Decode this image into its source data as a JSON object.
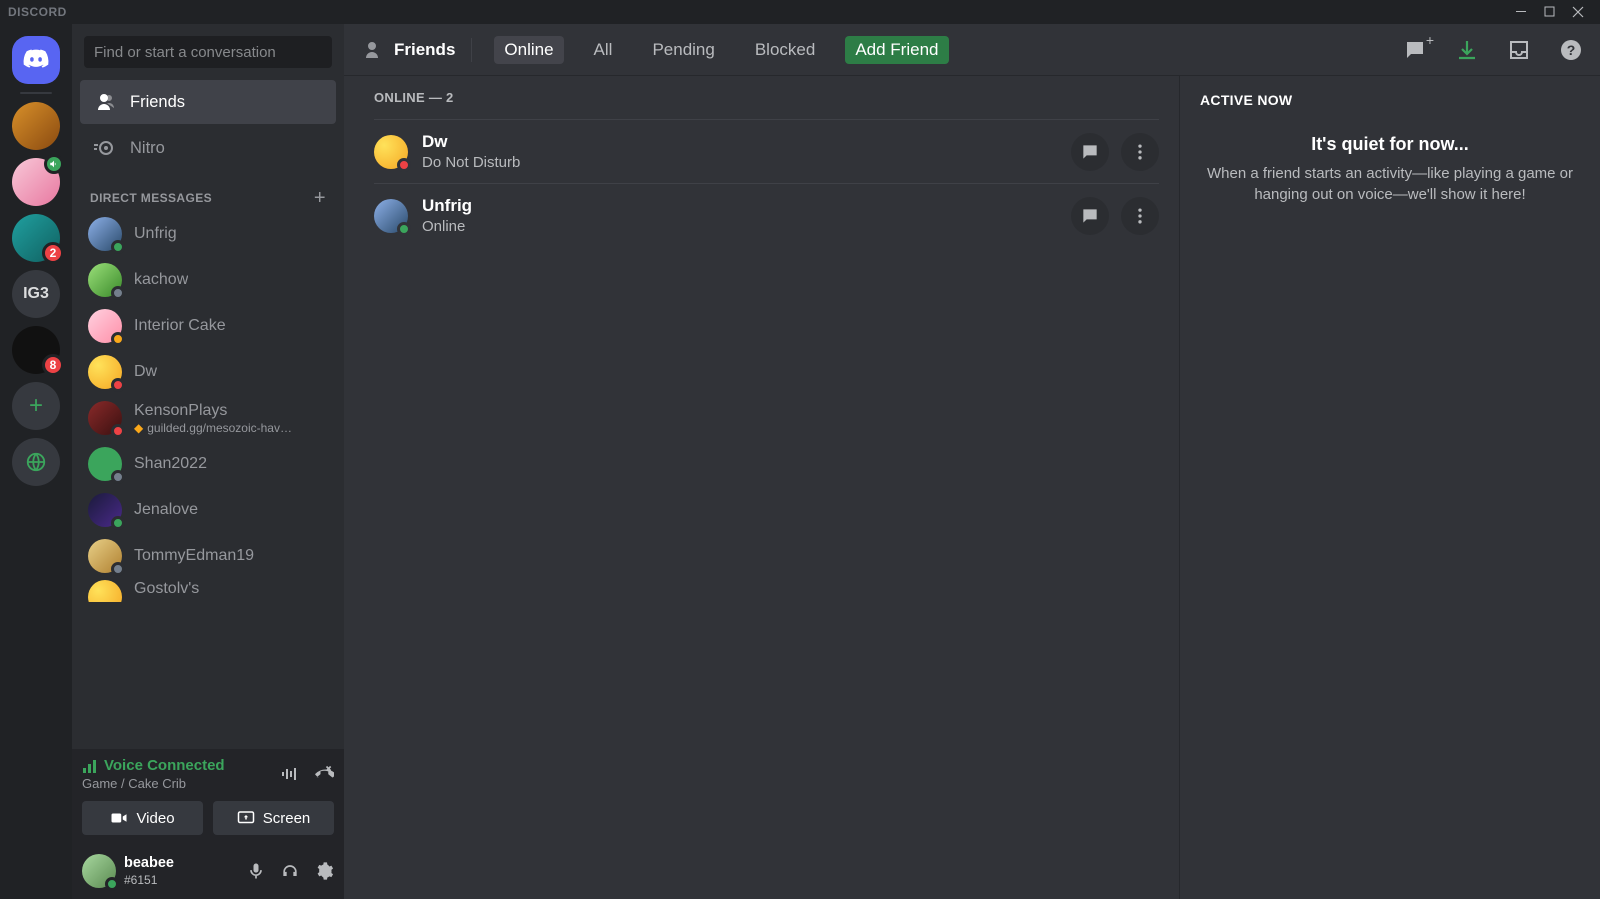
{
  "titlebar": {
    "brand": "DISCORD"
  },
  "rail": {
    "servers": [
      {
        "type": "home"
      },
      {
        "type": "img",
        "cls": "av10"
      },
      {
        "type": "img",
        "cls": "av11",
        "voice": true
      },
      {
        "type": "img",
        "cls": "av12",
        "badge": "2"
      },
      {
        "type": "text",
        "label": "IG3"
      },
      {
        "type": "img",
        "cls": "av13",
        "badge": "8"
      }
    ]
  },
  "sidebar": {
    "search_placeholder": "Find or start a conversation",
    "friends_label": "Friends",
    "nitro_label": "Nitro",
    "dm_header": "DIRECT MESSAGES",
    "dms": [
      {
        "name": "Unfrig",
        "av": "av1",
        "status": "mobile"
      },
      {
        "name": "kachow",
        "av": "av2",
        "status": "offline"
      },
      {
        "name": "Interior Cake",
        "av": "av3",
        "status": "idle"
      },
      {
        "name": "Dw",
        "av": "av4",
        "status": "dnd"
      },
      {
        "name": "KensonPlays",
        "av": "av5",
        "status": "dnd",
        "sub": "guilded.gg/mesozoic-hav…"
      },
      {
        "name": "Shan2022",
        "av": "av6",
        "status": "offline"
      },
      {
        "name": "Jenalove",
        "av": "av7",
        "status": "online"
      },
      {
        "name": "TommyEdman19",
        "av": "av8",
        "status": "offline"
      },
      {
        "name": "Gostolv's",
        "av": "av4",
        "status": "online",
        "cut": true
      }
    ]
  },
  "voice": {
    "status": "Voice Connected",
    "channel": "Game / Cake Crib",
    "video_label": "Video",
    "screen_label": "Screen"
  },
  "user": {
    "name": "beabee",
    "tag": "#6151",
    "av": "av9",
    "status": "online"
  },
  "topbar": {
    "title": "Friends",
    "tabs": {
      "online": "Online",
      "all": "All",
      "pending": "Pending",
      "blocked": "Blocked",
      "add": "Add Friend"
    }
  },
  "friends": {
    "section": "ONLINE — 2",
    "list": [
      {
        "name": "Dw",
        "status_text": "Do Not Disturb",
        "av": "av4",
        "status": "dnd"
      },
      {
        "name": "Unfrig",
        "status_text": "Online",
        "av": "av1",
        "status": "mobile"
      }
    ]
  },
  "active_now": {
    "title": "ACTIVE NOW",
    "heading": "It's quiet for now...",
    "body": "When a friend starts an activity—like playing a game or hanging out on voice—we'll show it here!"
  }
}
